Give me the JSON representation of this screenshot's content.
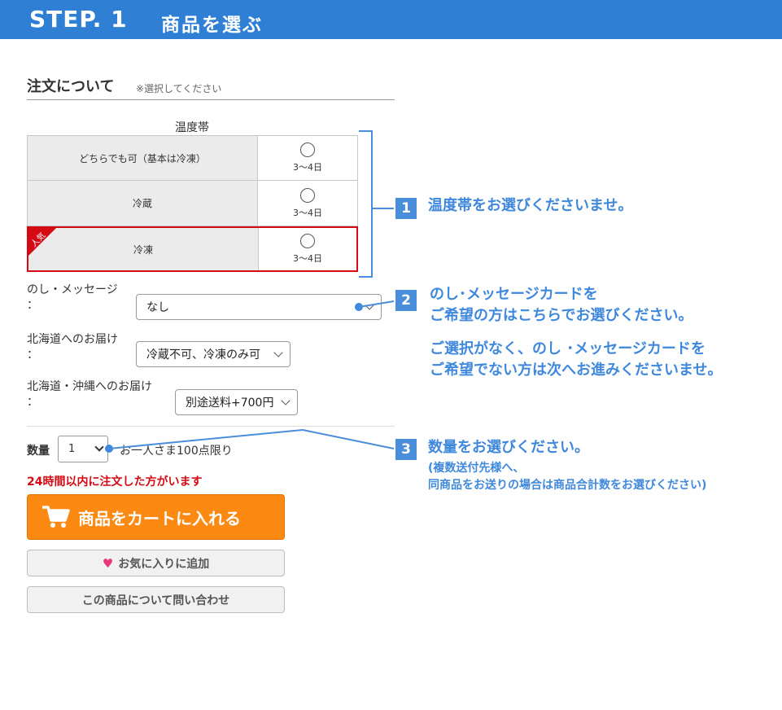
{
  "header": {
    "step": "STEP. 1",
    "title": "商品を選ぶ"
  },
  "order": {
    "heading": "注文について",
    "note": "※選択してください"
  },
  "temperature": {
    "label": "温度帯",
    "rows": [
      {
        "name": "どちらでも可（基本は冷凍）",
        "days": "3〜4日"
      },
      {
        "name": "冷蔵",
        "days": "3〜4日"
      },
      {
        "name": "冷凍",
        "days": "3〜4日",
        "badge": "人気"
      }
    ]
  },
  "noshi": {
    "label_line1": "のし・メッセージ",
    "label_line2": "：",
    "value": "なし"
  },
  "hokkaido": {
    "label_line1": "北海道へのお届け",
    "label_line2": "：",
    "value": "冷蔵不可、冷凍のみ可"
  },
  "okinawa": {
    "label_line1": "北海道・沖縄へのお届け",
    "label_line2": "：",
    "value": "別途送料+700円"
  },
  "quantity": {
    "label": "数量",
    "value": "1",
    "note": "お一人さま100点限り"
  },
  "alert": "24時間以内に注文した方がいます",
  "buttons": {
    "cart": "商品をカートに入れる",
    "favorite": "お気に入りに追加",
    "inquiry": "この商品について問い合わせ"
  },
  "instructions": {
    "step1": {
      "num": "1",
      "text": "温度帯をお選びくださいませ。"
    },
    "step2": {
      "num": "2",
      "line1": "のし･メッセージカードを",
      "line2": "ご希望の方はこちらでお選びください。",
      "line3": "ご選択がなく、のし ･メッセージカードを",
      "line4": "ご希望でない方は次へお進みくださいませ。"
    },
    "step3": {
      "num": "3",
      "text": "数量をお選びください。",
      "sub1": "(複数送付先様へ、",
      "sub2": "同商品をお送りの場合は商品合計数をお選びください)"
    }
  },
  "colors": {
    "header": "#2f7fd5",
    "accent": "#3f88dc",
    "cart": "#fc8a12",
    "alert": "#d40a14"
  }
}
